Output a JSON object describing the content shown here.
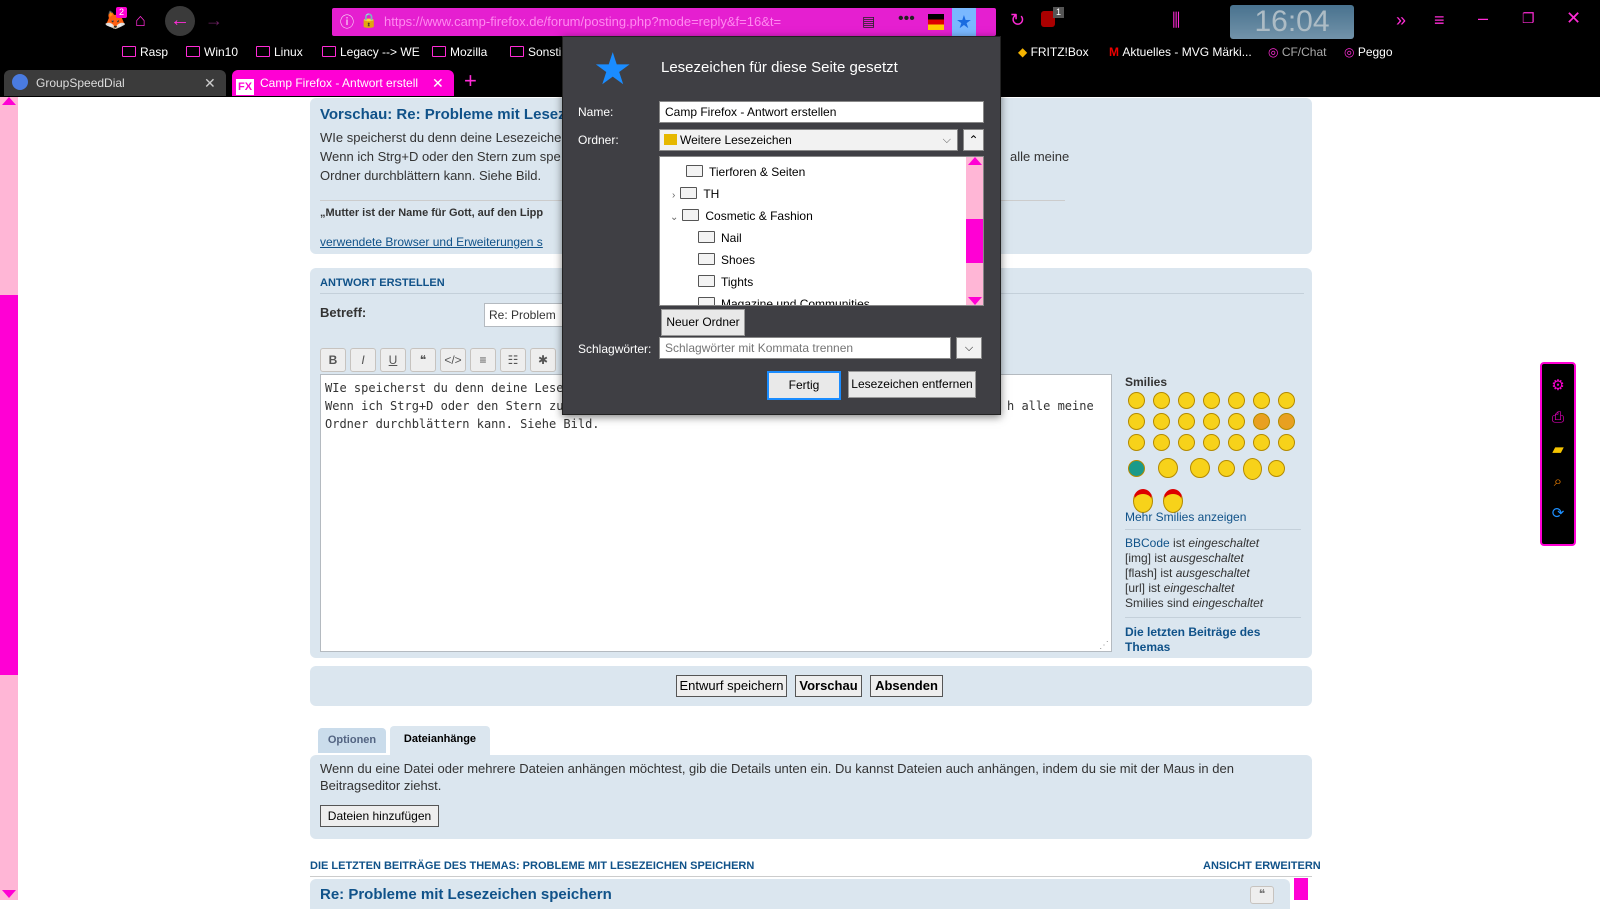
{
  "browser": {
    "url": "https://www.camp-firefox.de/forum/posting.php?mode=reply&f=16&t=",
    "clock": "16:04",
    "notif_badge": "2",
    "ublock_badge": "1",
    "bookmarks": [
      "Rasp",
      "Win10",
      "Linux",
      "Legacy --> WE",
      "Mozilla",
      "Sonsti",
      "FRITZ!Box",
      "Aktuelles - MVG Märki...",
      "CF/Chat",
      "Peggo"
    ],
    "tabs": [
      {
        "label": "GroupSpeedDial"
      },
      {
        "label": "Camp Firefox - Antwort erstell"
      }
    ],
    "accent": "#ff00d4"
  },
  "preview": {
    "title": "Vorschau: Re: Probleme mit Lesez",
    "line1": "WIe speicherst du denn deine Lesezeiche",
    "line2": "Wenn ich Strg+D oder den Stern zum spe",
    "line2_end": "alle meine",
    "line3": "Ordner durchblättern kann. Siehe Bild.",
    "quote": "„Mutter ist der Name für Gott, auf den Lipp",
    "signature_link": "verwendete Browser und Erweiterungen s"
  },
  "reply": {
    "header": "ANTWORT ERSTELLEN",
    "subject_label": "Betreff:",
    "subject_value": "Re: Problem",
    "editor_line1": "WIe speicherst du denn deine Lesezeiche",
    "editor_line2": "Wenn ich Strg+D oder den Stern zum spe",
    "editor_line2_end": "h alle meine",
    "editor_line3": "Ordner durchblättern kann. Siehe Bild.",
    "format_buttons": [
      "B",
      "I",
      "U",
      "❝",
      "</>",
      "≡",
      "☷",
      "✱"
    ],
    "smilies_title": "Smilies",
    "more_smilies": "Mehr Smilies anzeigen",
    "bbcode": {
      "a": "BBCode",
      "a2": " ist ",
      "a3": "eingeschaltet",
      "b": "[img] ist ",
      "b2": "ausgeschaltet",
      "c": "[flash] ist ",
      "c2": "ausgeschaltet",
      "d": "[url] ist ",
      "d2": "eingeschaltet",
      "e": "Smilies sind ",
      "e2": "eingeschaltet"
    },
    "last_posts_link": "Die letzten Beiträge des Themas",
    "buttons": {
      "draft": "Entwurf speichern",
      "preview": "Vorschau",
      "send": "Absenden"
    }
  },
  "attachments": {
    "tab_options": "Optionen",
    "tab_attachments": "Dateianhänge",
    "text": "Wenn du eine Datei oder mehrere Dateien anhängen möchtest, gib die Details unten ein. Du kannst Dateien auch anhängen, indem du sie mit der Maus in den Beitragseditor ziehst.",
    "add_button": "Dateien hinzufügen"
  },
  "footer": {
    "heading": "DIE LETZTEN BEITRÄGE DES THEMAS: PROBLEME MIT LESEZEICHEN SPEICHERN",
    "expand": "ANSICHT ERWEITERN",
    "post_title": "Re: Probleme mit Lesezeichen speichern"
  },
  "dialog": {
    "title": "Lesezeichen für diese Seite gesetzt",
    "name_label": "Name:",
    "name_value": "Camp Firefox - Antwort erstellen",
    "folder_label": "Ordner:",
    "folder_value": "Weitere Lesezeichen",
    "tree": [
      {
        "label": "Tierforen & Seiten"
      },
      {
        "label": "TH"
      },
      {
        "label": "Cosmetic & Fashion"
      },
      {
        "label": "Nail"
      },
      {
        "label": "Shoes"
      },
      {
        "label": "Tights"
      },
      {
        "label": "Magazine und Communities"
      }
    ],
    "new_folder": "Neuer Ordner",
    "tags_label": "Schlagwörter:",
    "tags_placeholder": "Schlagwörter mit Kommata trennen",
    "done": "Fertig",
    "remove": "Lesezeichen entfernen"
  }
}
